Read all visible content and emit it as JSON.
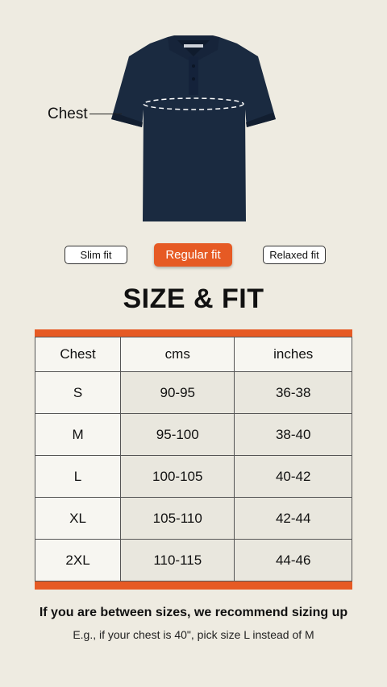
{
  "image": {
    "chest_label": "Chest",
    "icon": "polo-shirt"
  },
  "fit_options": [
    {
      "label": "Slim fit",
      "selected": false
    },
    {
      "label": "Regular fit",
      "selected": true
    },
    {
      "label": "Relaxed fit",
      "selected": false
    }
  ],
  "title": "SIZE & FIT",
  "accent_color": "#e65a24",
  "table": {
    "headers": [
      "Chest",
      "cms",
      "inches"
    ],
    "rows": [
      [
        "S",
        "90-95",
        "36-38"
      ],
      [
        "M",
        "95-100",
        "38-40"
      ],
      [
        "L",
        "100-105",
        "40-42"
      ],
      [
        "XL",
        "105-110",
        "42-44"
      ],
      [
        "2XL",
        "110-115",
        "44-46"
      ]
    ]
  },
  "note": {
    "main": "If you are between sizes, we recommend sizing up",
    "example": "E.g., if your chest is 40\", pick size L instead of M"
  }
}
